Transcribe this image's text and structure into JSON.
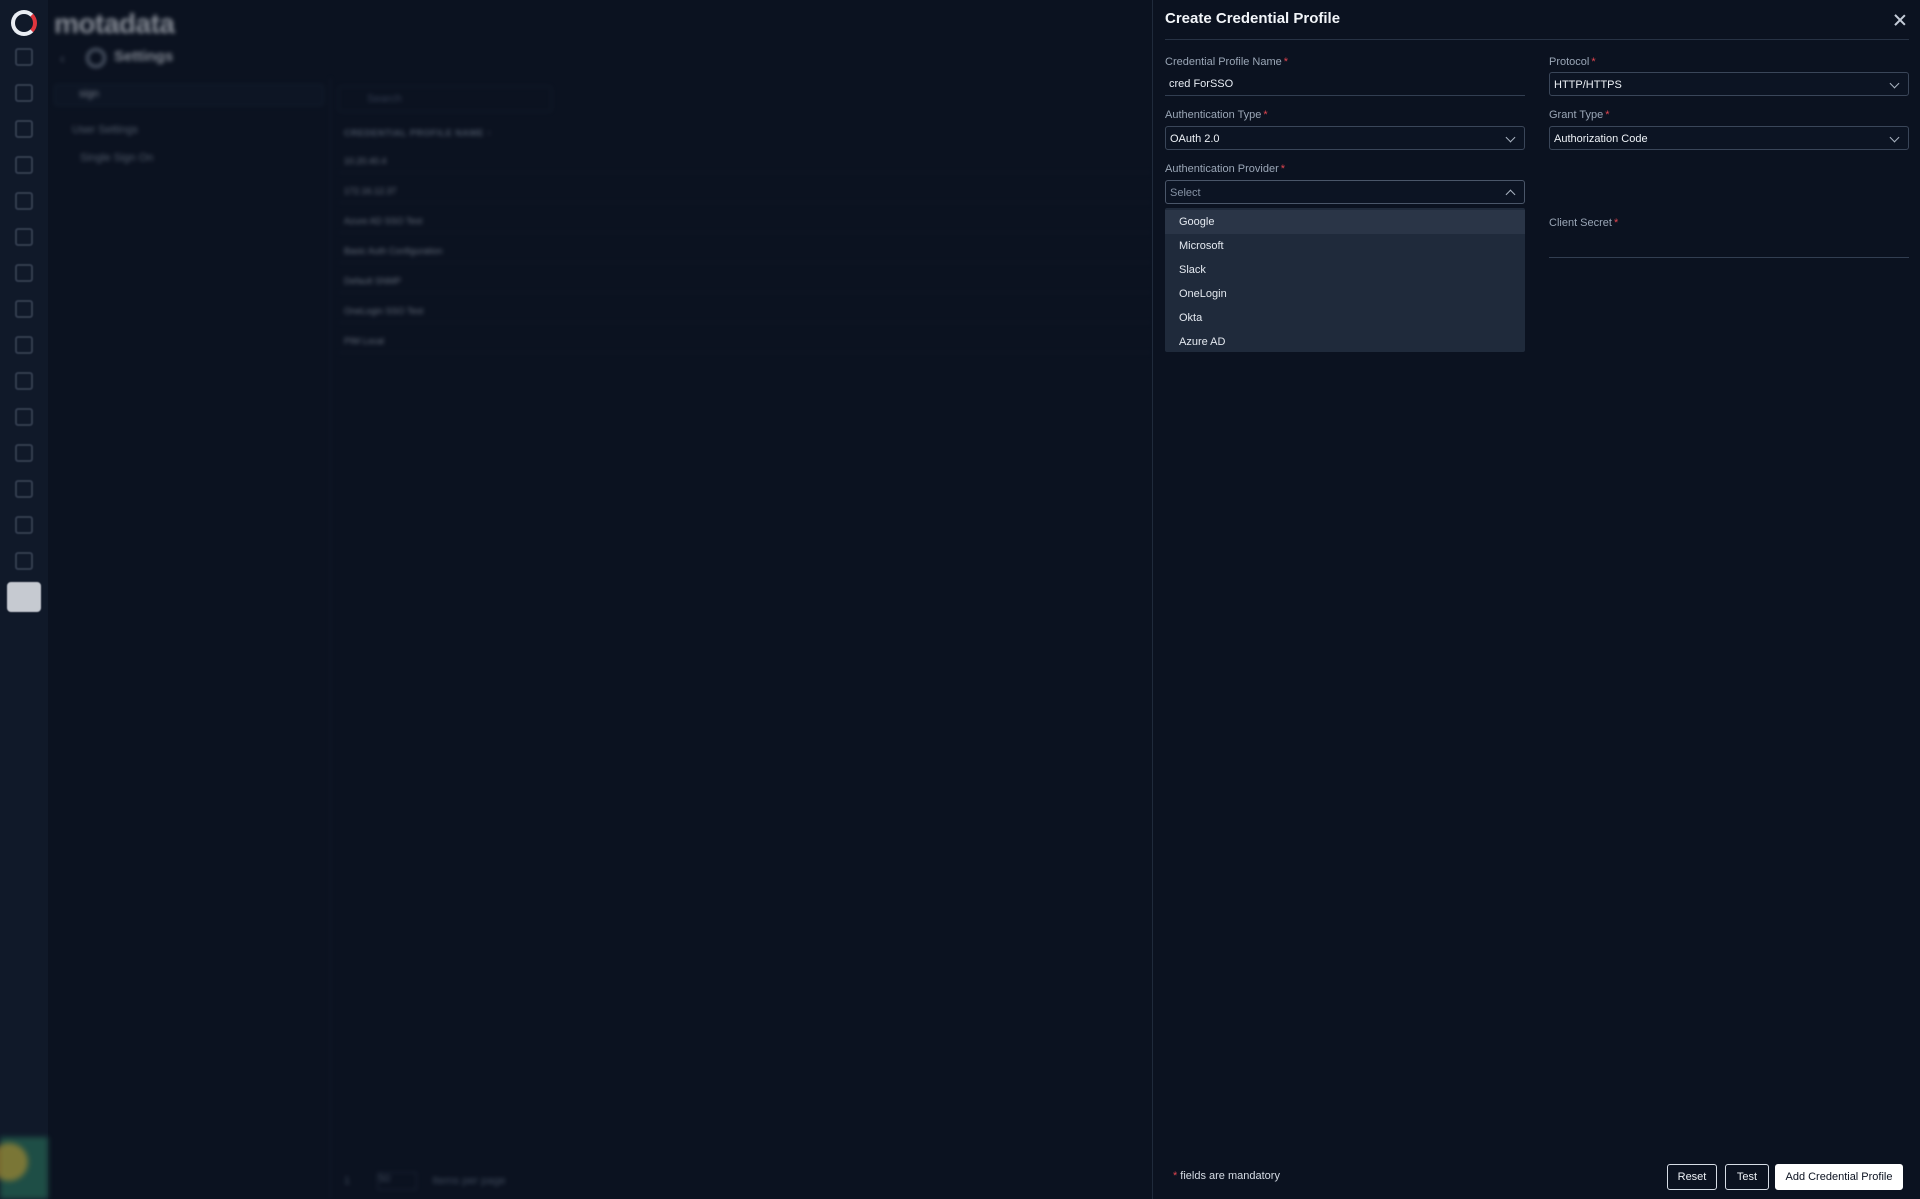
{
  "app": {
    "brand": "motadata"
  },
  "background": {
    "page_title": "Settings",
    "left_search_value": "sign",
    "tree_group": "User Settings",
    "tree_item": "Single Sign On",
    "search_placeholder": "Search",
    "table_header": "CREDENTIAL PROFILE NAME ↑",
    "rows": [
      "10.20.40.4",
      "172.16.12.37",
      "Azure AD SSO Test",
      "Basic Auth Configuration",
      "Default SNMP",
      "OneLogin SSO Test",
      "PIM Local"
    ],
    "pager": {
      "page": "1",
      "per_page": "50",
      "per_page_label": "Items per page"
    }
  },
  "drawer": {
    "title": "Create Credential Profile",
    "fields": {
      "profile_name": {
        "label": "Credential Profile Name",
        "value": "cred ForSSO"
      },
      "protocol": {
        "label": "Protocol",
        "value": "HTTP/HTTPS"
      },
      "auth_type": {
        "label": "Authentication Type",
        "value": "OAuth 2.0"
      },
      "grant_type": {
        "label": "Grant Type",
        "value": "Authorization Code"
      },
      "auth_provider": {
        "label": "Authentication Provider",
        "placeholder": "Select",
        "options": [
          "Google",
          "Microsoft",
          "Slack",
          "OneLogin",
          "Okta",
          "Azure AD"
        ],
        "highlighted": "Google"
      },
      "client_secret": {
        "label": "Client Secret",
        "value": ""
      }
    },
    "required_marker": "*",
    "mandatory_note": "fields are mandatory",
    "buttons": {
      "reset": "Reset",
      "test": "Test",
      "submit": "Add Credential Profile"
    }
  },
  "colors": {
    "required": "#e0454f",
    "drawer_bg": "#0b1220",
    "dropdown_bg": "#1f2a3b"
  }
}
